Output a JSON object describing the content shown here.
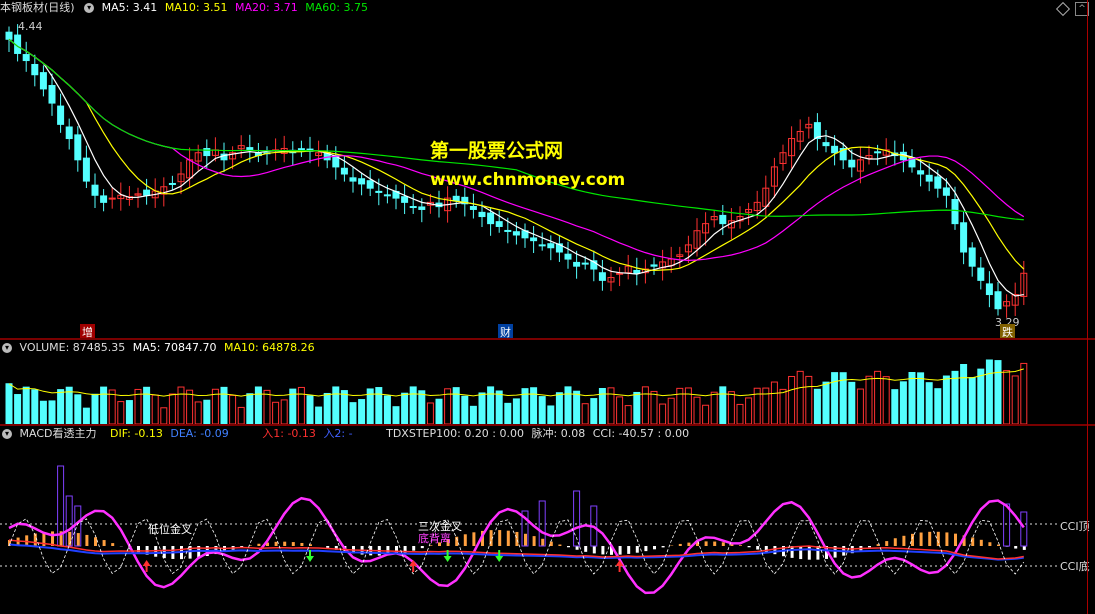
{
  "price_panel": {
    "title": "本钢板材(日线)",
    "ma5": "MA5: 3.41",
    "ma10": "MA10: 3.51",
    "ma20": "MA20: 3.71",
    "ma60": "MA60: 3.75",
    "high_label": "4.44",
    "low_label": "3.29",
    "marker_zeng": "增",
    "marker_cai": "财",
    "marker_die": "跌",
    "watermark_title": "第一股票公式网",
    "watermark_url": "www.chnmoney.com"
  },
  "volume_panel": {
    "title": "VOLUME: 87485.35",
    "ma5": "MA5: 70847.70",
    "ma10": "MA10: 64878.26"
  },
  "macd_panel": {
    "title": "MACD看透主力",
    "dif": "DIF: -0.13",
    "dea": "DEA: -0.09",
    "ru1": "入1: -0.13",
    "ru2": "入2: -",
    "tdx": "TDXSTEP100: 0.20 : 0.00",
    "maichong": "脉冲: 0.08",
    "cci": "CCI: -40.57 : 0.00",
    "label_lowcross": "低位金叉",
    "label_third": "三次金叉",
    "label_dragon": "底背离",
    "cci_top": "CCI顶",
    "cci_bottom": "CCI底"
  },
  "colors": {
    "up": "#ff3232",
    "down": "#54ffff",
    "ma5": "#ffffff",
    "ma10": "#ffff00",
    "ma20": "#ff00ff",
    "ma60": "#00e600",
    "watermark": "#ffff00"
  },
  "chart_data": {
    "type": "candlestick",
    "closes": [
      4.4,
      4.3,
      4.25,
      4.15,
      4.05,
      3.95,
      3.8,
      3.7,
      3.55,
      3.4,
      3.3,
      3.25,
      3.28,
      3.3,
      3.29,
      3.31,
      3.3,
      3.33,
      3.36,
      3.38,
      3.45,
      3.55,
      3.6,
      3.58,
      3.62,
      3.55,
      3.6,
      3.65,
      3.62,
      3.58,
      3.6,
      3.62,
      3.63,
      3.6,
      3.62,
      3.61,
      3.6,
      3.55,
      3.5,
      3.45,
      3.4,
      3.38,
      3.35,
      3.32,
      3.3,
      3.28,
      3.25,
      3.22,
      3.2,
      3.25,
      3.22,
      3.28,
      3.26,
      3.24,
      3.2,
      3.15,
      3.1,
      3.08,
      3.05,
      3.02,
      3.0,
      2.98,
      2.95,
      2.93,
      2.9,
      2.85,
      2.8,
      2.82,
      2.78,
      2.7,
      2.72,
      2.75,
      2.8,
      2.75,
      2.78,
      2.8,
      2.83,
      2.85,
      2.88,
      2.95,
      3.05,
      3.1,
      3.15,
      3.1,
      3.12,
      3.15,
      3.2,
      3.25,
      3.35,
      3.5,
      3.6,
      3.7,
      3.75,
      3.8,
      3.7,
      3.65,
      3.6,
      3.55,
      3.5,
      3.55,
      3.58,
      3.6,
      3.62,
      3.58,
      3.55,
      3.5,
      3.45,
      3.4,
      3.35,
      3.3,
      3.1,
      2.9,
      2.8,
      2.7,
      2.6,
      2.5,
      2.55,
      2.6,
      2.75
    ]
  }
}
